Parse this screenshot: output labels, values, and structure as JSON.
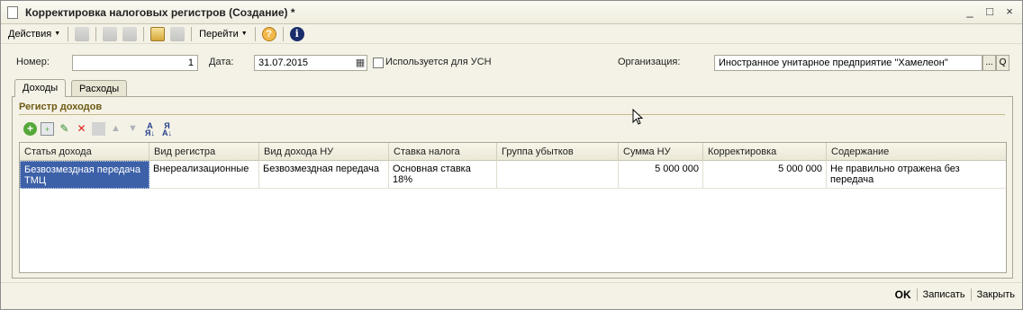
{
  "window": {
    "title": "Корректировка налоговых регистров (Создание) *",
    "controls": [
      "_",
      "□",
      "×"
    ]
  },
  "toolbar": {
    "actions_label": "Действия",
    "goto_label": "Перейти"
  },
  "header": {
    "number_label": "Номер:",
    "number_value": "1",
    "date_label": "Дата:",
    "date_value": "31.07.2015",
    "usn_checkbox_label": "Используется для УСН",
    "usn_checked": false,
    "org_label": "Организация:",
    "org_value": "Иностранное унитарное предприятие \"Хамелеон\"",
    "org_select_btn": "...",
    "org_open_btn": "Q"
  },
  "tabs": [
    {
      "label": "Доходы",
      "active": true
    },
    {
      "label": "Расходы",
      "active": false
    }
  ],
  "group": {
    "title": "Регистр доходов"
  },
  "grid": {
    "columns": [
      "Статья дохода",
      "Вид регистра",
      "Вид дохода НУ",
      "Ставка налога",
      "Группа убытков",
      "Сумма НУ",
      "Корректировка",
      "Содержание"
    ],
    "rows": [
      {
        "income_item": "Безвозмездная передача ТМЦ",
        "register_type": "Внереализационные",
        "income_type_nu": "Безвозмездная передача",
        "tax_rate": "Основная ставка 18%",
        "loss_group": "",
        "amount_nu": "5 000 000",
        "correction": "5 000 000",
        "content": "Не правильно отражена без передача"
      }
    ]
  },
  "footer": {
    "ok_label": "OK",
    "save_label": "Записать",
    "close_label": "Закрыть"
  },
  "colors": {
    "selection": "#3d61a8",
    "group_title": "#6e5a14",
    "background": "#f4f2e6"
  }
}
